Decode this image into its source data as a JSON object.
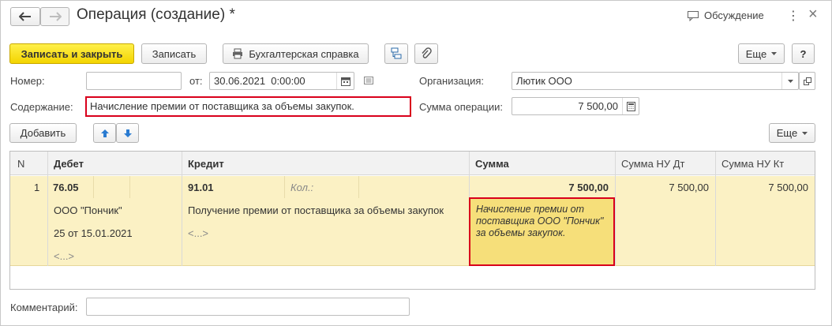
{
  "window": {
    "title": "Операция (создание) *",
    "discussion_label": "Обсуждение",
    "more_icon_label": "⋮",
    "close_icon_label": "×"
  },
  "toolbar": {
    "save_close_label": "Записать и закрыть",
    "save_label": "Записать",
    "accounting_ref_label": "Бухгалтерская справка",
    "more_label": "Еще",
    "help_label": "?"
  },
  "form": {
    "number_label": "Номер:",
    "number_value": "",
    "from_label": "от:",
    "date_value": "30.06.2021  0:00:00",
    "organization_label": "Организация:",
    "organization_value": "Лютик ООО",
    "content_label": "Содержание:",
    "content_value": "Начисление премии от поставщика за объемы закупок.",
    "amount_label": "Сумма операции:",
    "amount_value": "7 500,00",
    "comment_label": "Комментарий:",
    "comment_value": ""
  },
  "table_toolbar": {
    "add_label": "Добавить",
    "more_label": "Еще"
  },
  "table": {
    "headers": {
      "n": "N",
      "debit": "Дебет",
      "credit": "Кредит",
      "sum": "Сумма",
      "sum_nu_dt": "Сумма НУ Дт",
      "sum_nu_kt": "Сумма НУ Кт"
    },
    "rows": [
      {
        "n": "1",
        "debit_account": "76.05",
        "debit_sub1": "ООО \"Пончик\"",
        "debit_sub2": "25 от 15.01.2021",
        "debit_sub3": "<...>",
        "credit_account": "91.01",
        "credit_qty_label": "Кол.:",
        "credit_sub1": "Получение премии от поставщика за объемы закупок",
        "credit_sub2": "<...>",
        "sum": "7 500,00",
        "content": "Начисление премии от поставщика ООО \"Пончик\" за объемы закупок.",
        "sum_nu_dt": "7 500,00",
        "sum_nu_kt": "7 500,00"
      }
    ]
  },
  "colors": {
    "accent_yellow": "#f3d400",
    "selected_row": "#fbf1c4",
    "highlight_red": "#d9001b",
    "note_bg": "#f6df7a"
  }
}
